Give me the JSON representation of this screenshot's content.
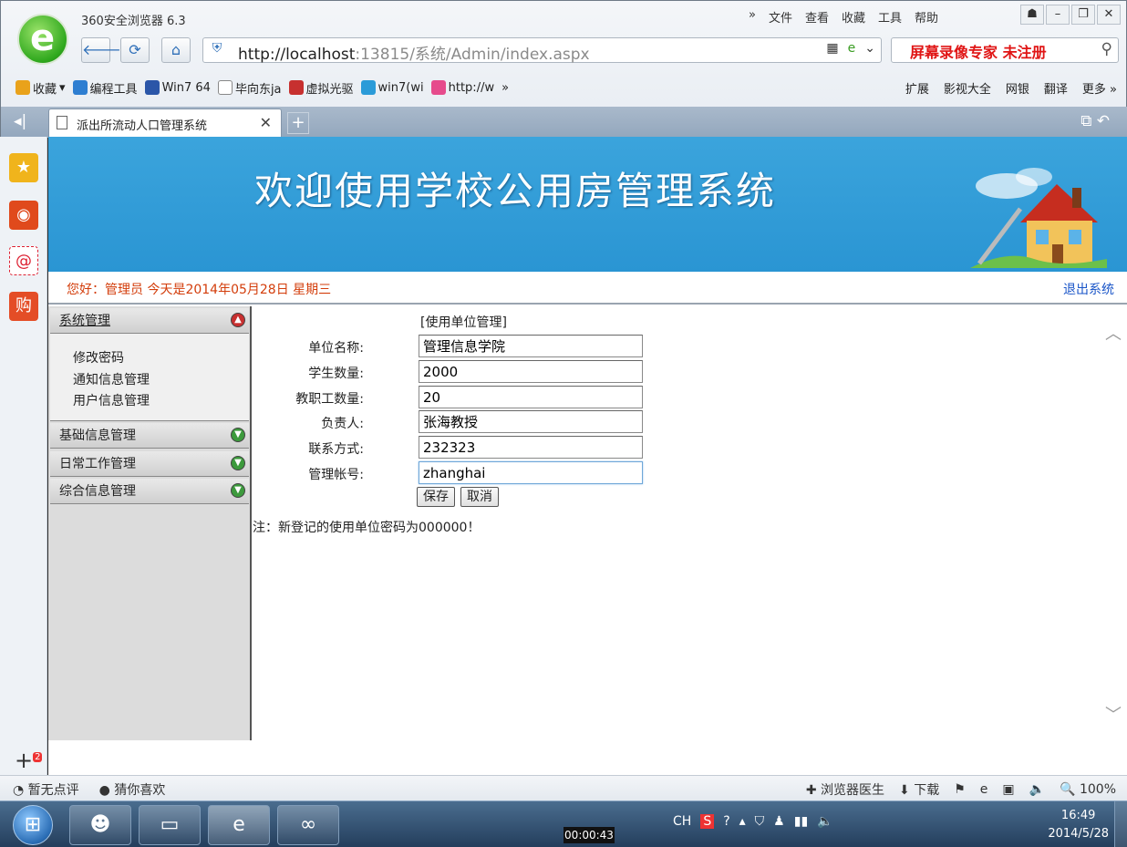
{
  "browser": {
    "title": "360安全浏览器 6.3",
    "menu": [
      "»",
      "文件",
      "查看",
      "收藏",
      "工具",
      "帮助"
    ],
    "url_host": "http://localhost",
    "url_rest": ":13815/系统/Admin/index.aspx",
    "search_overlay": "屏幕录像专家  未注册",
    "favorites": [
      {
        "label": "收藏",
        "color": "#e9a21b"
      },
      {
        "label": "编程工具",
        "color": "#2e7ed1"
      },
      {
        "label": "Win7 64",
        "color": "#2b56a8"
      },
      {
        "label": "毕向东ja",
        "color": "#ffffff"
      },
      {
        "label": "虚拟光驱",
        "color": "#c7302f"
      },
      {
        "label": "win7(wi",
        "color": "#2b9bd8"
      },
      {
        "label": "http://w",
        "color": "#e64b8c"
      }
    ],
    "fav_more": "»",
    "fav_right": [
      "扩展",
      "影视大全",
      "网银",
      "翻译",
      "更多 »"
    ],
    "tab_title": "派出所流动人口管理系统"
  },
  "page": {
    "banner_title": "欢迎使用学校公用房管理系统",
    "welcome": "您好：管理员    今天是2014年05月28日    星期三",
    "logout": "退出系统"
  },
  "sidebar": {
    "sections": [
      {
        "label": "系统管理",
        "state": "open"
      },
      {
        "label": "基础信息管理",
        "state": "closed"
      },
      {
        "label": "日常工作管理",
        "state": "closed"
      },
      {
        "label": "综合信息管理",
        "state": "closed"
      }
    ],
    "sub_items": [
      "修改密码",
      "通知信息管理",
      "用户信息管理"
    ]
  },
  "form": {
    "title": "[使用单位管理]",
    "fields": [
      {
        "label": "单位名称:",
        "value": "管理信息学院"
      },
      {
        "label": "学生数量:",
        "value": "2000"
      },
      {
        "label": "教职工数量:",
        "value": "20"
      },
      {
        "label": "负责人:",
        "value": "张海教授"
      },
      {
        "label": "联系方式:",
        "value": "232323"
      },
      {
        "label": "管理帐号:",
        "value": "zhanghai"
      }
    ],
    "save": "保存",
    "cancel": "取消",
    "note": "注：新登记的使用单位密码为000000！"
  },
  "statusbar": {
    "left": [
      "暂无点评",
      "猜你喜欢"
    ],
    "right": [
      "浏览器医生",
      "下载",
      "100%"
    ]
  },
  "taskbar": {
    "timer": "00:00:43",
    "lang": "CH",
    "time": "16:49",
    "date": "2014/5/28"
  }
}
